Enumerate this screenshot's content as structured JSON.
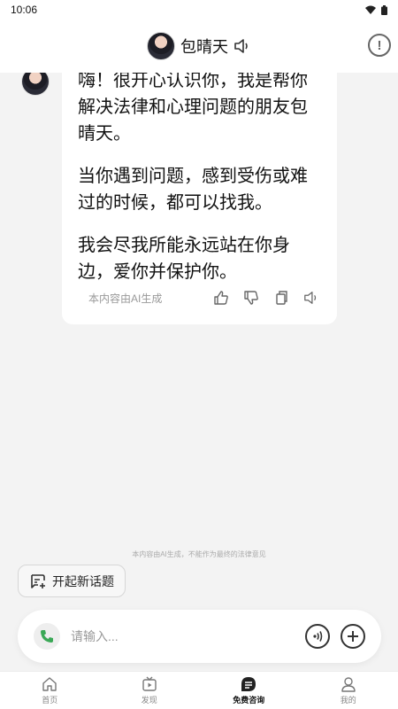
{
  "status_bar": {
    "time": "10:06"
  },
  "header": {
    "title": "包晴天"
  },
  "message": {
    "paragraphs": [
      "嗨！很开心认识你，我是帮你解决法律和心理问题的朋友包晴天。",
      "当你遇到问题，感到受伤或难过的时候，都可以找我。",
      "我会尽我所能永远站在你身边，爱你并保护你。"
    ],
    "ai_note": "本内容由AI生成"
  },
  "disclaimer": "本内容由AI生成，不能作为最终的法律意见",
  "new_topic_label": "开起新话题",
  "input": {
    "placeholder": "请输入..."
  },
  "nav": {
    "items": [
      {
        "label": "首页"
      },
      {
        "label": "发现"
      },
      {
        "label": "免费咨询"
      },
      {
        "label": "我的"
      }
    ]
  }
}
